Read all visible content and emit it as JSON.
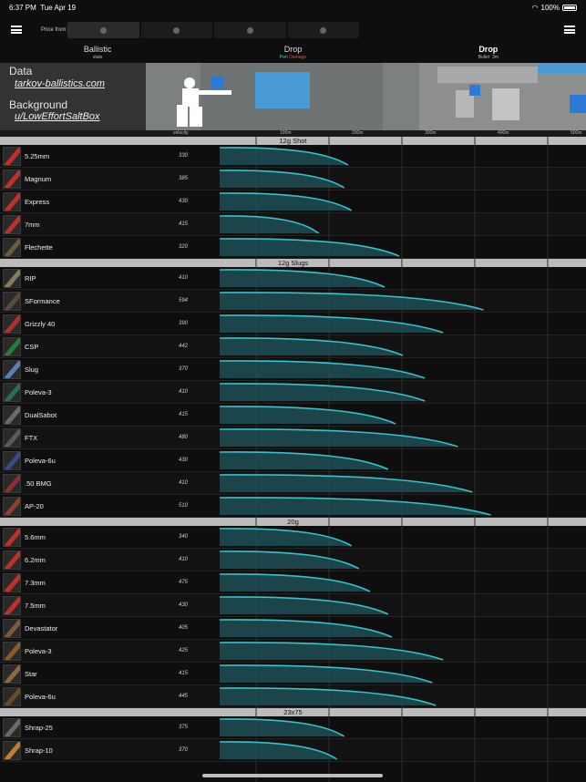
{
  "status": {
    "time": "6:37 PM",
    "date": "Tue Apr 19",
    "battery": "100%"
  },
  "topbar": {
    "price_label": "Price from:"
  },
  "tabs": [
    {
      "title": "Ballistic",
      "sub": "stats"
    },
    {
      "title": "Drop",
      "sub_pen": "Pen",
      "sub_dmg": "Damage"
    },
    {
      "title": "Drop",
      "sub": "Bullet",
      "extra": "3m"
    }
  ],
  "credits": {
    "data_heading": "Data",
    "data_value": "tarkov-ballistics.com",
    "background_heading": "Background",
    "background_value": "u/LowEffortSaltBox"
  },
  "axis": {
    "label": "velocity",
    "ticks": [
      "100m",
      "200m",
      "300m",
      "400m",
      "500m"
    ]
  },
  "colors": {
    "accent": "#3a7bd5",
    "curve": "#33c4cc",
    "fill": "#1f4e56"
  },
  "sections": [
    {
      "title": "12g Shot",
      "items": [
        {
          "name": "5.25mm",
          "velocity": "330",
          "drop": 0.35,
          "color": "#c0302a"
        },
        {
          "name": "Magnum",
          "velocity": "385",
          "drop": 0.34,
          "color": "#c0302a"
        },
        {
          "name": "Express",
          "velocity": "430",
          "drop": 0.36,
          "color": "#c0302a"
        },
        {
          "name": "7mm",
          "velocity": "415",
          "drop": 0.27,
          "color": "#c0302a"
        },
        {
          "name": "Flechette",
          "velocity": "320",
          "drop": 0.49,
          "color": "#6a5a40"
        }
      ]
    },
    {
      "title": "12g Slugs",
      "items": [
        {
          "name": "RIP",
          "velocity": "410",
          "drop": 0.45,
          "color": "#8a7a60"
        },
        {
          "name": "SFormance",
          "velocity": "594",
          "drop": 0.72,
          "color": "#5a4a3a"
        },
        {
          "name": "Grizzly 40",
          "velocity": "390",
          "drop": 0.61,
          "color": "#b0302a"
        },
        {
          "name": "CSP",
          "velocity": "442",
          "drop": 0.5,
          "color": "#2a7a3a"
        },
        {
          "name": "Slug",
          "velocity": "370",
          "drop": 0.56,
          "color": "#5a80b0"
        },
        {
          "name": "Poleva-3",
          "velocity": "410",
          "drop": 0.56,
          "color": "#2a6a60"
        },
        {
          "name": "DualSabot",
          "velocity": "415",
          "drop": 0.48,
          "color": "#6a6a6a"
        },
        {
          "name": "FTX",
          "velocity": "480",
          "drop": 0.65,
          "color": "#5a5a5a"
        },
        {
          "name": "Poleva-6u",
          "velocity": "430",
          "drop": 0.46,
          "color": "#3a4a8a"
        },
        {
          "name": ".50 BMG",
          "velocity": "410",
          "drop": 0.69,
          "color": "#8a3030"
        },
        {
          "name": "AP-20",
          "velocity": "510",
          "drop": 0.74,
          "color": "#8a4030"
        }
      ]
    },
    {
      "title": "20g",
      "items": [
        {
          "name": "5.6mm",
          "velocity": "340",
          "drop": 0.36,
          "color": "#c0302a"
        },
        {
          "name": "6.2mm",
          "velocity": "410",
          "drop": 0.38,
          "color": "#c0302a"
        },
        {
          "name": "7.3mm",
          "velocity": "475",
          "drop": 0.41,
          "color": "#c0302a"
        },
        {
          "name": "7.5mm",
          "velocity": "430",
          "drop": 0.46,
          "color": "#c0302a"
        },
        {
          "name": "Devastator",
          "velocity": "405",
          "drop": 0.47,
          "color": "#7a5a3a"
        },
        {
          "name": "Poleva-3",
          "velocity": "425",
          "drop": 0.61,
          "color": "#8a5a2a"
        },
        {
          "name": "Star",
          "velocity": "415",
          "drop": 0.58,
          "color": "#8a6a3a"
        },
        {
          "name": "Poleva-6u",
          "velocity": "445",
          "drop": 0.59,
          "color": "#6a4a2a"
        }
      ]
    },
    {
      "title": "23x75",
      "items": [
        {
          "name": "Shrap-25",
          "velocity": "375",
          "drop": 0.34,
          "color": "#6a6a6a"
        },
        {
          "name": "Shrap-10",
          "velocity": "370",
          "drop": 0.32,
          "color": "#c08030"
        }
      ]
    }
  ]
}
